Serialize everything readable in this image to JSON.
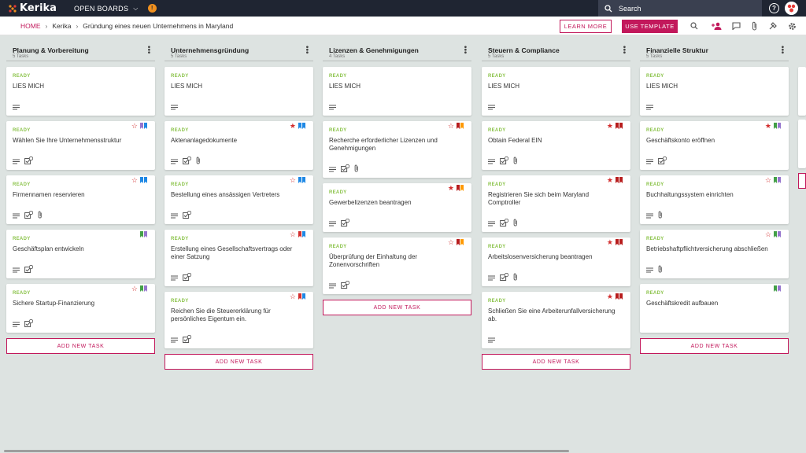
{
  "app": {
    "name": "Kerika",
    "boards_label": "OPEN BOARDS",
    "notif_count": "!",
    "search_placeholder": "Search",
    "help": "?"
  },
  "breadcrumb": [
    "HOME",
    "Kerika",
    "Gründung eines neuen Unternehmens in Maryland"
  ],
  "buttons": {
    "learn_more": "LEARN MORE",
    "use_template": "USE TEMPLATE"
  },
  "colors": {
    "brand": "#c2185b",
    "ready": "#8bc34a",
    "topbar": "#1f2532",
    "red": "#d32f2f",
    "blue": "#1e88e5",
    "purple": "#9575cd",
    "green": "#43a047",
    "orange": "#ff9800",
    "darkred": "#b71c1c"
  },
  "columns": [
    {
      "title": "Planung & Vorbereitung",
      "count": "5 Tasks",
      "add_label": "ADD NEW TASK",
      "cards": [
        {
          "status": "READY",
          "title": "LIES MICH",
          "flags": [],
          "icons": [
            "desc"
          ]
        },
        {
          "status": "READY",
          "title": "Wählen Sie Ihre Unternehmensstruktur",
          "star": "outline",
          "flags": [
            "purple",
            "blue"
          ],
          "icons": [
            "desc",
            "check"
          ]
        },
        {
          "status": "READY",
          "title": "Firmennamen reservieren",
          "star": "outline",
          "flags": [
            "blue",
            "blue"
          ],
          "icons": [
            "desc",
            "check",
            "clip"
          ]
        },
        {
          "status": "READY",
          "title": "Geschäftsplan entwickeln",
          "flags": [
            "green",
            "purple"
          ],
          "icons": [
            "desc",
            "check"
          ]
        },
        {
          "status": "READY",
          "title": "Sichere Startup-Finanzierung",
          "star": "outline",
          "flags": [
            "green",
            "purple"
          ],
          "icons": [
            "desc",
            "check"
          ]
        }
      ]
    },
    {
      "title": "Unternehmensgründung",
      "count": "5 Tasks",
      "add_label": "ADD NEW TASK",
      "cards": [
        {
          "status": "READY",
          "title": "LIES MICH",
          "flags": [],
          "icons": [
            "desc"
          ]
        },
        {
          "status": "READY",
          "title": "Aktenanlagedokumente",
          "star": "filled",
          "flags": [
            "blue",
            "blue"
          ],
          "icons": [
            "desc",
            "check",
            "clip"
          ]
        },
        {
          "status": "READY",
          "title": "Bestellung eines ansässigen Vertreters",
          "star": "outline",
          "flags": [
            "blue",
            "blue"
          ],
          "icons": [
            "desc",
            "check"
          ]
        },
        {
          "status": "READY",
          "title": "Erstellung eines Gesellschaftsvertrags oder einer Satzung",
          "star": "outline",
          "flags": [
            "red",
            "blue"
          ],
          "icons": [
            "desc",
            "check"
          ]
        },
        {
          "status": "READY",
          "title": "Reichen Sie die Steuererklärung für persönliches Eigentum ein.",
          "star": "outline",
          "flags": [
            "red",
            "blue"
          ],
          "icons": [
            "desc",
            "check"
          ]
        }
      ]
    },
    {
      "title": "Lizenzen & Genehmigungen",
      "count": "4 Tasks",
      "add_label": "ADD NEW TASK",
      "cards": [
        {
          "status": "READY",
          "title": "LIES MICH",
          "flags": [],
          "icons": [
            "desc"
          ]
        },
        {
          "status": "READY",
          "title": "Recherche erforderlicher Lizenzen und Genehmigungen",
          "star": "outline",
          "flags": [
            "darkred",
            "orange"
          ],
          "icons": [
            "desc",
            "check",
            "clip"
          ]
        },
        {
          "status": "READY",
          "title": "Gewerbelizenzen beantragen",
          "star": "filled",
          "flags": [
            "darkred",
            "orange"
          ],
          "icons": [
            "desc",
            "check"
          ]
        },
        {
          "status": "READY",
          "title": "Überprüfung der Einhaltung der Zonenvorschriften",
          "star": "outline",
          "flags": [
            "darkred",
            "orange"
          ],
          "icons": [
            "desc",
            "check"
          ]
        }
      ]
    },
    {
      "title": "Steuern & Compliance",
      "count": "5 Tasks",
      "add_label": "ADD NEW TASK",
      "cards": [
        {
          "status": "READY",
          "title": "LIES MICH",
          "flags": [],
          "icons": [
            "desc"
          ]
        },
        {
          "status": "READY",
          "title": "Obtain Federal EIN",
          "star": "filled",
          "flags": [
            "darkred",
            "darkred"
          ],
          "icons": [
            "desc",
            "check",
            "clip"
          ]
        },
        {
          "status": "READY",
          "title": "Registrieren Sie sich beim Maryland Comptroller",
          "star": "filled",
          "flags": [
            "darkred",
            "darkred"
          ],
          "icons": [
            "desc",
            "check",
            "clip"
          ]
        },
        {
          "status": "READY",
          "title": "Arbeitslosenversicherung beantragen",
          "star": "filled",
          "flags": [
            "darkred",
            "darkred"
          ],
          "icons": [
            "desc",
            "check",
            "clip"
          ]
        },
        {
          "status": "READY",
          "title": "Schließen Sie eine Arbeiterunfallversicherung ab.",
          "star": "filled",
          "flags": [
            "darkred",
            "darkred"
          ],
          "icons": [
            "desc"
          ]
        }
      ]
    },
    {
      "title": "Finanzielle Struktur",
      "count": "5 Tasks",
      "add_label": "ADD NEW TASK",
      "cards": [
        {
          "status": "READY",
          "title": "LIES MICH",
          "flags": [],
          "icons": [
            "desc"
          ]
        },
        {
          "status": "READY",
          "title": "Geschäftskonto eröffnen",
          "star": "filled",
          "flags": [
            "green",
            "purple"
          ],
          "icons": [
            "desc",
            "check"
          ]
        },
        {
          "status": "READY",
          "title": "Buchhaltungssystem einrichten",
          "star": "outline",
          "flags": [
            "green",
            "purple"
          ],
          "icons": [
            "desc",
            "clip"
          ]
        },
        {
          "status": "READY",
          "title": "Betriebshaftpflichtversicherung abschließen",
          "star": "outline",
          "flags": [
            "green",
            "purple"
          ],
          "icons": [
            "desc",
            "clip"
          ]
        },
        {
          "status": "READY",
          "title": "Geschäftskredit aufbauen",
          "flags": [
            "green",
            "purple"
          ],
          "icons": []
        }
      ]
    }
  ]
}
